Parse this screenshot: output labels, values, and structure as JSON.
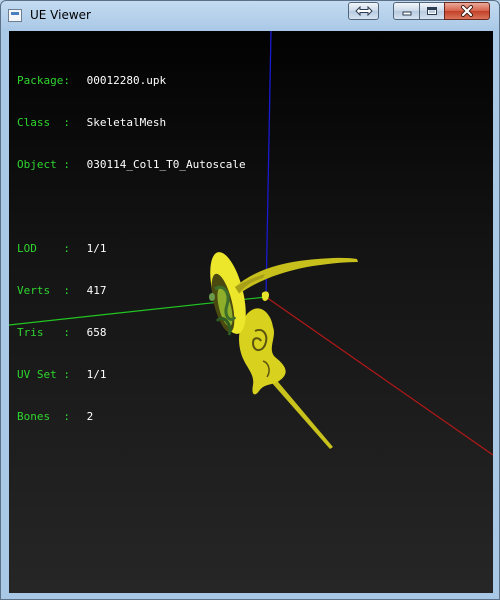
{
  "window": {
    "title": "UE Viewer"
  },
  "titlebar_buttons": {
    "restore": "restore-swap-icon",
    "minimize": "minimize-icon",
    "maximize": "maximize-icon",
    "close": "close-icon"
  },
  "info": {
    "package_label": "Package:",
    "package_value": "00012280.upk",
    "class_label": "Class  :",
    "class_value": "SkeletalMesh",
    "object_label": "Object :",
    "object_value": "030114_Col1_T0_Autoscale",
    "lod_label": "LOD    :",
    "lod_value": "1/1",
    "verts_label": "Verts  :",
    "verts_value": "417",
    "tris_label": "Tris   :",
    "tris_value": "658",
    "uvset_label": "UV Set :",
    "uvset_value": "1/1",
    "bones_label": "Bones  :",
    "bones_value": "2"
  },
  "colors": {
    "info_label": "#2fd52f",
    "info_value": "#ffffff",
    "axis_x": "#b01818",
    "axis_y": "#22c522",
    "axis_z": "#1a1ad0",
    "mesh": "#e4e020"
  }
}
